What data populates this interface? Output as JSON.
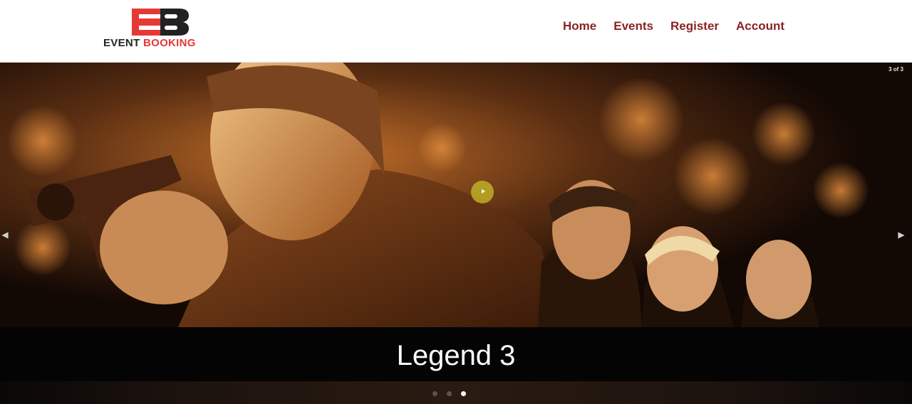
{
  "brand": {
    "mark_text": "EB",
    "word_one": "EVENT",
    "word_two": "BOOKING",
    "colors": {
      "red": "#e53935",
      "dark": "#222222"
    }
  },
  "nav": {
    "items": [
      {
        "label": "Home"
      },
      {
        "label": "Events"
      },
      {
        "label": "Register"
      },
      {
        "label": "Account"
      }
    ],
    "link_color": "#8b2323"
  },
  "carousel": {
    "counter": "3 of 3",
    "prev_icon": "chevron-left-icon",
    "next_icon": "chevron-right-icon",
    "caption": "Legend 3",
    "slide_count": 3,
    "active_index": 3,
    "image_name": "movie-poster-image"
  }
}
